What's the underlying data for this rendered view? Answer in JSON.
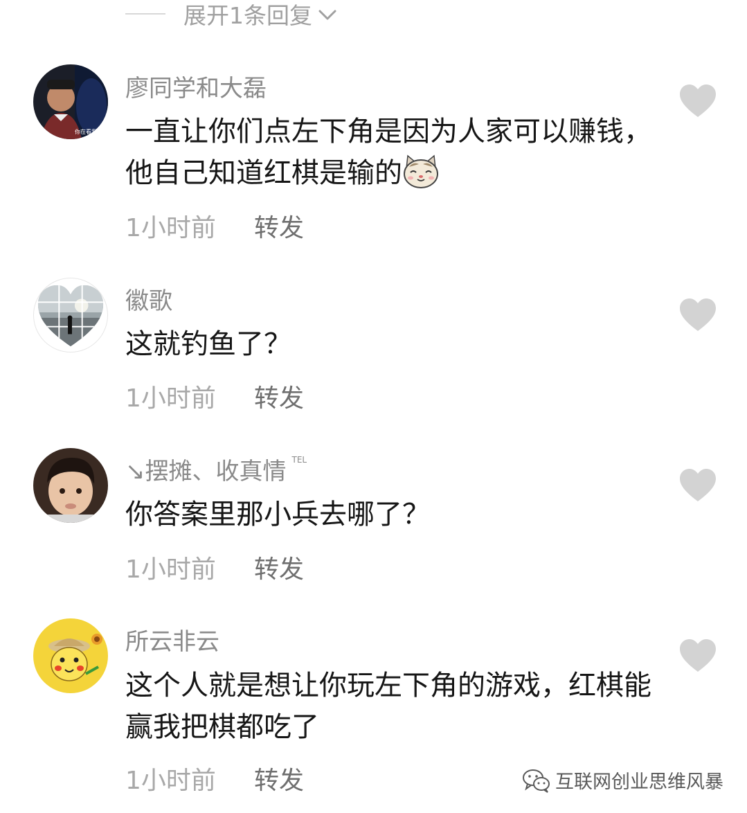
{
  "expand_replies": {
    "label": "展开1条回复",
    "icon": "chevron-down-icon"
  },
  "comments": [
    {
      "username": "廖同学和大磊",
      "badge": "",
      "text": "一直让你们点左下角是因为人家可以赚钱，他自己知道红棋是输的",
      "emoji": "cat-face-emoji",
      "time": "1小时前",
      "forward": "转发"
    },
    {
      "username": "徽歌",
      "badge": "",
      "text": "这就钓鱼了？",
      "emoji": "",
      "time": "1小时前",
      "forward": "转发"
    },
    {
      "username": "↘摆摊、收真情",
      "badge": "TEL",
      "text": "你答案里那小兵去哪了？",
      "emoji": "",
      "time": "1小时前",
      "forward": "转发"
    },
    {
      "username": "所云非云",
      "badge": "",
      "text": "这个人就是想让你玩左下角的游戏，红棋能赢我把棋都吃了",
      "emoji": "",
      "time": "1小时前",
      "forward": "转发"
    }
  ],
  "watermark": {
    "text": "互联网创业思维风暴",
    "icon": "wechat-icon"
  },
  "colors": {
    "username": "#8a8a8a",
    "text": "#161616",
    "meta": "#a8a8a8",
    "like": "#d3d3d3"
  }
}
